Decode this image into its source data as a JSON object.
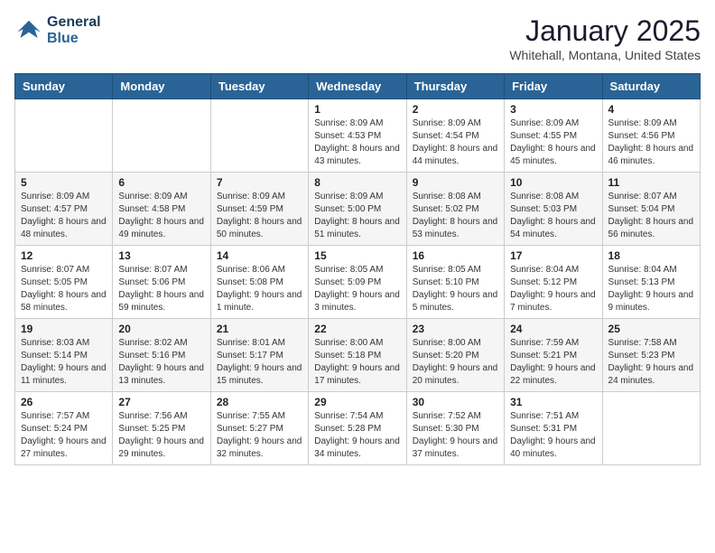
{
  "header": {
    "logo_line1": "General",
    "logo_line2": "Blue",
    "month": "January 2025",
    "location": "Whitehall, Montana, United States"
  },
  "weekdays": [
    "Sunday",
    "Monday",
    "Tuesday",
    "Wednesday",
    "Thursday",
    "Friday",
    "Saturday"
  ],
  "weeks": [
    [
      {
        "day": "",
        "content": ""
      },
      {
        "day": "",
        "content": ""
      },
      {
        "day": "",
        "content": ""
      },
      {
        "day": "1",
        "content": "Sunrise: 8:09 AM\nSunset: 4:53 PM\nDaylight: 8 hours and 43 minutes."
      },
      {
        "day": "2",
        "content": "Sunrise: 8:09 AM\nSunset: 4:54 PM\nDaylight: 8 hours and 44 minutes."
      },
      {
        "day": "3",
        "content": "Sunrise: 8:09 AM\nSunset: 4:55 PM\nDaylight: 8 hours and 45 minutes."
      },
      {
        "day": "4",
        "content": "Sunrise: 8:09 AM\nSunset: 4:56 PM\nDaylight: 8 hours and 46 minutes."
      }
    ],
    [
      {
        "day": "5",
        "content": "Sunrise: 8:09 AM\nSunset: 4:57 PM\nDaylight: 8 hours and 48 minutes."
      },
      {
        "day": "6",
        "content": "Sunrise: 8:09 AM\nSunset: 4:58 PM\nDaylight: 8 hours and 49 minutes."
      },
      {
        "day": "7",
        "content": "Sunrise: 8:09 AM\nSunset: 4:59 PM\nDaylight: 8 hours and 50 minutes."
      },
      {
        "day": "8",
        "content": "Sunrise: 8:09 AM\nSunset: 5:00 PM\nDaylight: 8 hours and 51 minutes."
      },
      {
        "day": "9",
        "content": "Sunrise: 8:08 AM\nSunset: 5:02 PM\nDaylight: 8 hours and 53 minutes."
      },
      {
        "day": "10",
        "content": "Sunrise: 8:08 AM\nSunset: 5:03 PM\nDaylight: 8 hours and 54 minutes."
      },
      {
        "day": "11",
        "content": "Sunrise: 8:07 AM\nSunset: 5:04 PM\nDaylight: 8 hours and 56 minutes."
      }
    ],
    [
      {
        "day": "12",
        "content": "Sunrise: 8:07 AM\nSunset: 5:05 PM\nDaylight: 8 hours and 58 minutes."
      },
      {
        "day": "13",
        "content": "Sunrise: 8:07 AM\nSunset: 5:06 PM\nDaylight: 8 hours and 59 minutes."
      },
      {
        "day": "14",
        "content": "Sunrise: 8:06 AM\nSunset: 5:08 PM\nDaylight: 9 hours and 1 minute."
      },
      {
        "day": "15",
        "content": "Sunrise: 8:05 AM\nSunset: 5:09 PM\nDaylight: 9 hours and 3 minutes."
      },
      {
        "day": "16",
        "content": "Sunrise: 8:05 AM\nSunset: 5:10 PM\nDaylight: 9 hours and 5 minutes."
      },
      {
        "day": "17",
        "content": "Sunrise: 8:04 AM\nSunset: 5:12 PM\nDaylight: 9 hours and 7 minutes."
      },
      {
        "day": "18",
        "content": "Sunrise: 8:04 AM\nSunset: 5:13 PM\nDaylight: 9 hours and 9 minutes."
      }
    ],
    [
      {
        "day": "19",
        "content": "Sunrise: 8:03 AM\nSunset: 5:14 PM\nDaylight: 9 hours and 11 minutes."
      },
      {
        "day": "20",
        "content": "Sunrise: 8:02 AM\nSunset: 5:16 PM\nDaylight: 9 hours and 13 minutes."
      },
      {
        "day": "21",
        "content": "Sunrise: 8:01 AM\nSunset: 5:17 PM\nDaylight: 9 hours and 15 minutes."
      },
      {
        "day": "22",
        "content": "Sunrise: 8:00 AM\nSunset: 5:18 PM\nDaylight: 9 hours and 17 minutes."
      },
      {
        "day": "23",
        "content": "Sunrise: 8:00 AM\nSunset: 5:20 PM\nDaylight: 9 hours and 20 minutes."
      },
      {
        "day": "24",
        "content": "Sunrise: 7:59 AM\nSunset: 5:21 PM\nDaylight: 9 hours and 22 minutes."
      },
      {
        "day": "25",
        "content": "Sunrise: 7:58 AM\nSunset: 5:23 PM\nDaylight: 9 hours and 24 minutes."
      }
    ],
    [
      {
        "day": "26",
        "content": "Sunrise: 7:57 AM\nSunset: 5:24 PM\nDaylight: 9 hours and 27 minutes."
      },
      {
        "day": "27",
        "content": "Sunrise: 7:56 AM\nSunset: 5:25 PM\nDaylight: 9 hours and 29 minutes."
      },
      {
        "day": "28",
        "content": "Sunrise: 7:55 AM\nSunset: 5:27 PM\nDaylight: 9 hours and 32 minutes."
      },
      {
        "day": "29",
        "content": "Sunrise: 7:54 AM\nSunset: 5:28 PM\nDaylight: 9 hours and 34 minutes."
      },
      {
        "day": "30",
        "content": "Sunrise: 7:52 AM\nSunset: 5:30 PM\nDaylight: 9 hours and 37 minutes."
      },
      {
        "day": "31",
        "content": "Sunrise: 7:51 AM\nSunset: 5:31 PM\nDaylight: 9 hours and 40 minutes."
      },
      {
        "day": "",
        "content": ""
      }
    ]
  ]
}
